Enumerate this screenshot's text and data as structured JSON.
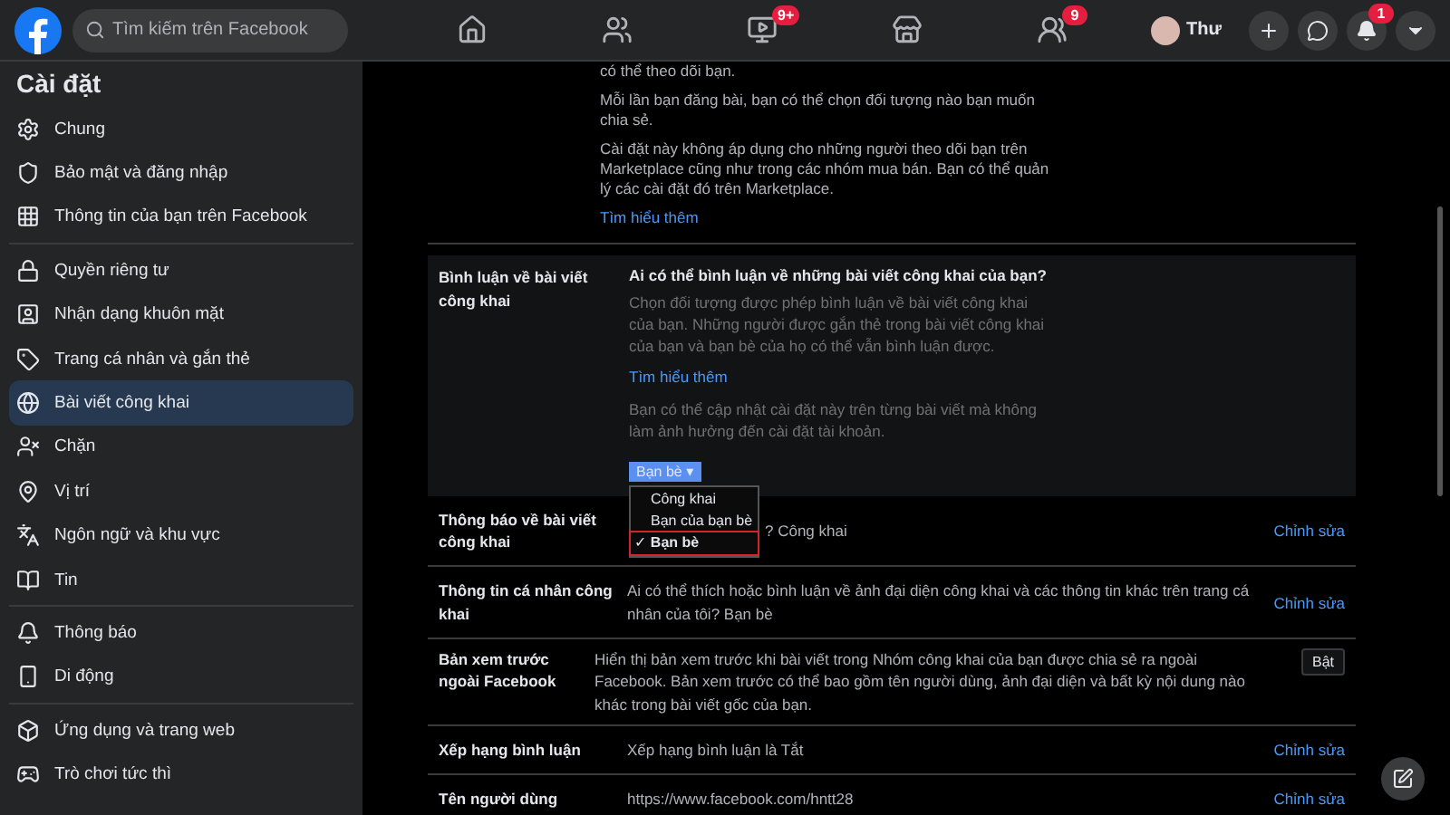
{
  "header": {
    "search": {
      "placeholder": "Tìm kiếm trên Facebook"
    },
    "nav": [
      {
        "kind": "home"
      },
      {
        "kind": "friends"
      },
      {
        "kind": "video",
        "badge": "9+"
      },
      {
        "kind": "market"
      },
      {
        "kind": "groups",
        "badge": "9"
      }
    ],
    "profile": {
      "name": "Thư"
    },
    "actions": [
      {
        "kind": "plus"
      },
      {
        "kind": "messenger"
      },
      {
        "kind": "bell",
        "badge": "1"
      },
      {
        "kind": "menu"
      }
    ]
  },
  "sidebar": {
    "title": "Cài đặt",
    "groups": [
      [
        {
          "label": "Chung",
          "selected": false
        },
        {
          "label": "Bảo mật và đăng nhập",
          "selected": false
        },
        {
          "label": "Thông tin của bạn trên Facebook",
          "selected": false
        }
      ],
      [
        {
          "label": "Quyền riêng tư",
          "selected": false
        },
        {
          "label": "Nhận dạng khuôn mặt",
          "selected": false
        },
        {
          "label": "Trang cá nhân và gắn thẻ",
          "selected": false
        },
        {
          "label": "Bài viết công khai",
          "selected": true
        },
        {
          "label": "Chặn",
          "selected": false
        },
        {
          "label": "Vị trí",
          "selected": false
        },
        {
          "label": "Ngôn ngữ và khu vực",
          "selected": false
        },
        {
          "label": "Tin",
          "selected": false
        }
      ],
      [
        {
          "label": "Thông báo",
          "selected": false
        },
        {
          "label": "Di động",
          "selected": false
        }
      ],
      [
        {
          "label": "Ứng dụng và trang web",
          "selected": false
        },
        {
          "label": "Trò chơi tức thì",
          "selected": false
        }
      ]
    ]
  },
  "intro": {
    "paragraphs": [
      "có thể theo dõi bạn.",
      "Mỗi lần bạn đăng bài, bạn có thể chọn đối tượng nào bạn muốn chia sẻ.",
      "Cài đặt này không áp dụng cho những người theo dõi bạn trên Marketplace cũng như trong các nhóm mua bán. Bạn có thể quản lý các cài đặt đó trên Marketplace."
    ],
    "link": "Tìm hiểu thêm"
  },
  "comments": {
    "label": "Bình luận về bài viết công khai",
    "question": "Ai có thể bình luận về những bài viết công khai của bạn?",
    "description": "Chọn đối tượng được phép bình luận về bài viết công khai của bạn. Những người được gắn thẻ trong bài viết công khai của bạn và bạn bè của họ có thể vẫn bình luận được.",
    "link": "Tìm hiểu thêm",
    "note": "Bạn có thể cập nhật cài đặt này trên từng bài viết mà không làm ảnh hưởng đến cài đặt tài khoản.",
    "dropdown": {
      "value": "Bạn bè",
      "caret": "▾",
      "open": true,
      "options": [
        {
          "label": "Công khai",
          "selected": false
        },
        {
          "label": "Bạn của bạn bè",
          "selected": false
        },
        {
          "label": "Bạn bè",
          "selected": true
        }
      ],
      "check": "✓"
    }
  },
  "rows": [
    {
      "kind": "edit",
      "label": "Thông báo về bài viết công khai",
      "value": "? Công khai",
      "action": "Chỉnh sửa"
    },
    {
      "kind": "edit",
      "label": "Thông tin cá nhân công khai",
      "value": "Ai có thể thích hoặc bình luận về ảnh đại diện công khai và các thông tin khác trên trang cá nhân của tôi? Bạn bè",
      "action": "Chỉnh sửa"
    },
    {
      "kind": "toggle",
      "label": "Bản xem trước ngoài Facebook",
      "value": "Hiển thị bản xem trước khi bài viết trong Nhóm công khai của bạn được chia sẻ ra ngoài Facebook. Bản xem trước có thể bao gồm tên người dùng, ảnh đại diện và bất kỳ nội dung nào khác trong bài viết gốc của bạn.",
      "action": "Bật"
    },
    {
      "kind": "edit",
      "label": "Xếp hạng bình luận",
      "value": "Xếp hạng bình luận là Tắt",
      "action": "Chỉnh sửa"
    },
    {
      "kind": "edit",
      "label": "Tên người dùng",
      "value": "https://www.facebook.com/hntt28",
      "action": "Chỉnh sửa"
    }
  ]
}
